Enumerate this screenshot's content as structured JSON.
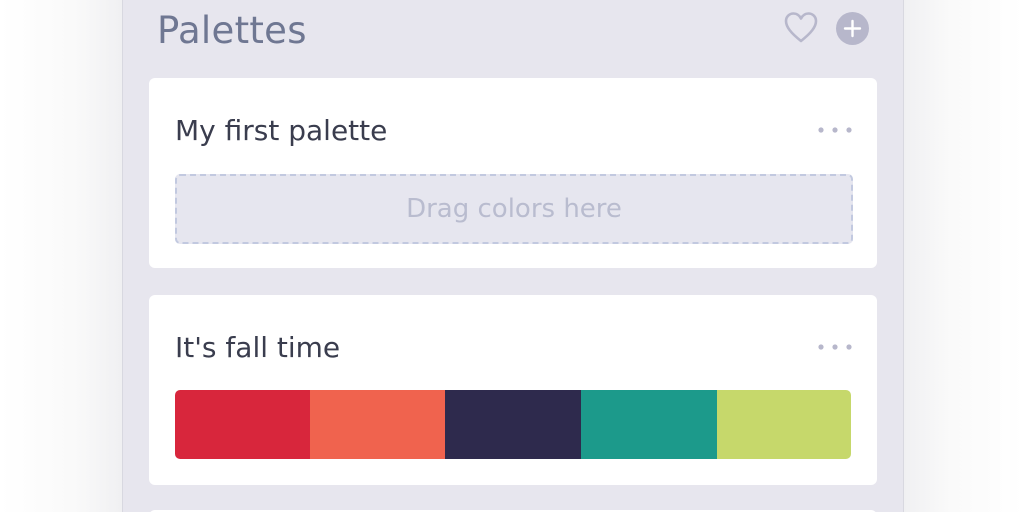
{
  "panel": {
    "title": "Palettes"
  },
  "header": {
    "favorite_icon": "heart-outline-icon",
    "add_icon": "plus-circle-icon"
  },
  "palettes": [
    {
      "title": "My first palette",
      "more_icon": "more-horizontal-icon",
      "dropzone_text": "Drag colors here",
      "colors": []
    },
    {
      "title": "It's fall time",
      "more_icon": "more-horizontal-icon",
      "colors": [
        {
          "hex": "#d8263c",
          "share": 0.199
        },
        {
          "hex": "#f0634e",
          "share": 0.201
        },
        {
          "hex": "#2e2a4d",
          "share": 0.2
        },
        {
          "hex": "#1c9a8b",
          "share": 0.202
        },
        {
          "hex": "#c6d86b",
          "share": 0.198
        }
      ]
    }
  ],
  "colors": {
    "panel_bg": "#e7e6ee",
    "title_text": "#6f7792",
    "icon_muted": "#b7b7cb",
    "card_bg": "#ffffff"
  }
}
